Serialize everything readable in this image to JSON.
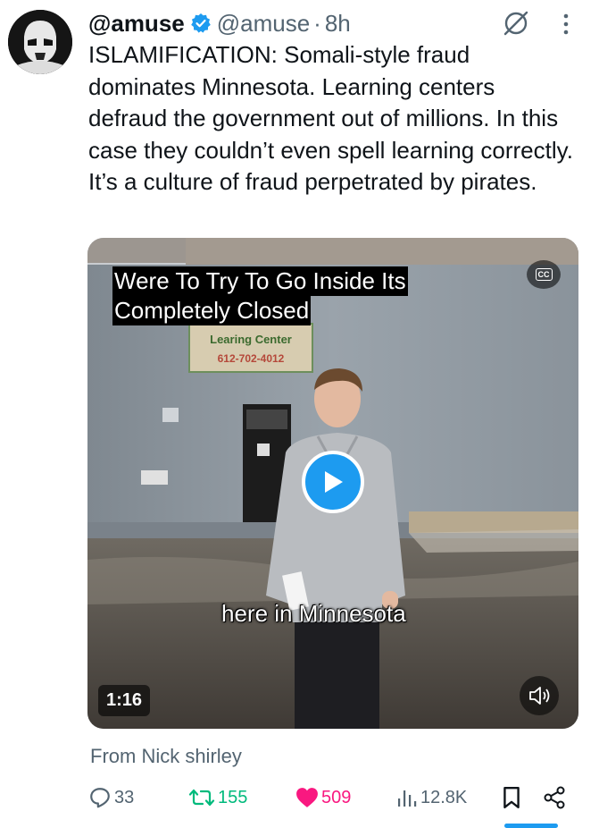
{
  "tweet": {
    "display_name": "@amuse",
    "handle": "@amuse",
    "separator": "·",
    "time": "8h",
    "text": "ISLAMIFICATION: Somali-style fraud dominates Minnesota. Learning centers defraud the government out of millions. In this case they couldn’t even spell learning correctly. It’s a culture of fraud perpetrated by pirates.",
    "source": "From Nick shirley"
  },
  "video": {
    "caption_line1": "Were To Try To Go Inside Its",
    "caption_line2": "Completely Closed",
    "caption_bottom": "here in Minnesota",
    "sign_text": "Learing Center",
    "sign_phone": "612-702-4012",
    "cc_label": "CC",
    "duration": "1:16"
  },
  "actions": {
    "replies": "33",
    "retweets": "155",
    "likes": "509",
    "views": "12.8K"
  },
  "icons": {
    "verified": "verified-badge-icon",
    "grok": "grok-icon",
    "more": "more-options-icon",
    "reply": "reply-icon",
    "retweet": "retweet-icon",
    "like": "heart-icon",
    "views": "views-icon",
    "bookmark": "bookmark-icon",
    "share": "share-icon",
    "play": "play-icon",
    "volume": "volume-icon"
  },
  "colors": {
    "accent": "#1d9bf0",
    "retweet": "#00ba7c",
    "like": "#f91880",
    "secondary_text": "#536471"
  }
}
